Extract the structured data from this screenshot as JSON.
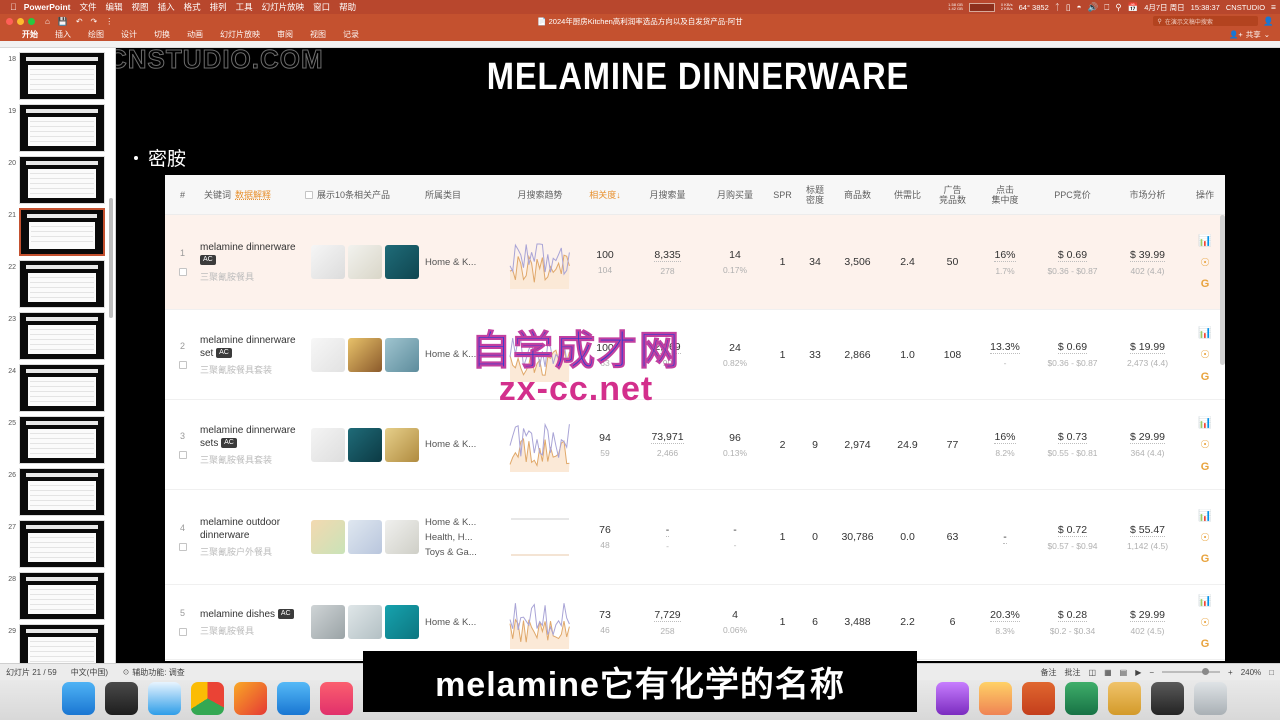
{
  "menubar": {
    "apple": "apple-logo",
    "items": [
      "PowerPoint",
      "文件",
      "编辑",
      "视图",
      "插入",
      "格式",
      "排列",
      "工具",
      "幻灯片放映",
      "窗口",
      "帮助"
    ],
    "net_up": "1.58 GB",
    "net_down": "1.42 GB",
    "cpu_up": "0 KB/s",
    "cpu_down": "2 KB/s",
    "temp": "64° 3852",
    "battery": "18%",
    "date": "4月7日 周日",
    "time": "15:38:37",
    "user": "CNSTUDIO"
  },
  "titlebar": {
    "document": "2024年厨房Kitchen高利润率选品方向以及自发货产品-阿甘",
    "quick_access": [
      "home-icon",
      "save-icon",
      "undo-icon",
      "redo-icon",
      "add-icon"
    ],
    "search_placeholder": "在演示文稿中搜索",
    "share_label": "共享"
  },
  "ribbon": {
    "tabs": [
      "开始",
      "插入",
      "绘图",
      "设计",
      "切换",
      "动画",
      "幻灯片放映",
      "审阅",
      "视图",
      "记录"
    ],
    "active_tab": "开始"
  },
  "slide_panel": {
    "slides": [
      {
        "number": "18"
      },
      {
        "number": "19"
      },
      {
        "number": "20"
      },
      {
        "number": "21",
        "selected": true
      },
      {
        "number": "22"
      },
      {
        "number": "23"
      },
      {
        "number": "24"
      },
      {
        "number": "25"
      },
      {
        "number": "26"
      },
      {
        "number": "27"
      },
      {
        "number": "28"
      },
      {
        "number": "29"
      }
    ]
  },
  "slide": {
    "title": "MELAMINE DINNERWARE",
    "bullet": "密胺",
    "watermark_corner": "CNSTUDIO.COM",
    "watermark_line1": "自学成才网",
    "watermark_line2": "zx-cc.net"
  },
  "table": {
    "headers": {
      "index": "#",
      "keyword": "关键词",
      "data_explain": "数据解释",
      "show_related": "展示10条相关产品",
      "category": "所属类目",
      "trend": "月搜索趋势",
      "relevance": "相关度",
      "sort_arrow": "↓",
      "search_volume": "月搜索量",
      "purchase_volume": "月购买量",
      "spr": "SPR",
      "title_density_1": "标题",
      "title_density_2": "密度",
      "product_count": "商品数",
      "supply_demand": "供需比",
      "ad_comp_1": "广告",
      "ad_comp_2": "竞品数",
      "click_conc_1": "点击",
      "click_conc_2": "集中度",
      "ppc": "PPC竞价",
      "market": "市场分析",
      "actions": "操作"
    },
    "rows": [
      {
        "index": "1",
        "keyword": "melamine dinnerware",
        "badge": "AC",
        "keyword_cn": "三聚氰胺餐具",
        "categories": [
          "Home & K..."
        ],
        "relevance": "100",
        "relevance_sub": "104",
        "search_volume": "8,335",
        "search_volume_sub": "278",
        "purchase_volume": "14",
        "purchase_volume_sub": "0.17%",
        "spr": "1",
        "title_density": "34",
        "product_count": "3,506",
        "supply_demand": "2.4",
        "ad_competitors": "50",
        "click_conc": "16%",
        "click_conc_sub": "1.7%",
        "ppc": "$ 0.69",
        "ppc_range": "$0.36 - $0.87",
        "market_price": "$ 39.99",
        "market_sub": "402 (4.4)",
        "highlight": true
      },
      {
        "index": "2",
        "keyword": "melamine dinnerware set",
        "badge": "AC",
        "keyword_cn": "三聚氰胺餐具套装",
        "categories": [
          "Home & K..."
        ],
        "relevance": "100",
        "relevance_sub": "63",
        "search_volume": "2,969",
        "search_volume_sub": "99",
        "purchase_volume": "24",
        "purchase_volume_sub": "0.82%",
        "spr": "1",
        "title_density": "33",
        "product_count": "2,866",
        "supply_demand": "1.0",
        "ad_competitors": "108",
        "click_conc": "13.3%",
        "click_conc_sub": "-",
        "ppc": "$ 0.69",
        "ppc_range": "$0.36 - $0.87",
        "market_price": "$ 19.99",
        "market_sub": "2,473 (4.4)",
        "highlight": false
      },
      {
        "index": "3",
        "keyword": "melamine dinnerware sets",
        "badge": "AC",
        "keyword_cn": "三聚氰胺餐具套装",
        "categories": [
          "Home & K..."
        ],
        "relevance": "94",
        "relevance_sub": "59",
        "search_volume": "73,971",
        "search_volume_sub": "2,466",
        "purchase_volume": "96",
        "purchase_volume_sub": "0.13%",
        "spr": "2",
        "title_density": "9",
        "product_count": "2,974",
        "supply_demand": "24.9",
        "ad_competitors": "77",
        "click_conc": "16%",
        "click_conc_sub": "8.2%",
        "ppc": "$ 0.73",
        "ppc_range": "$0.55 - $0.81",
        "market_price": "$ 29.99",
        "market_sub": "364 (4.4)",
        "highlight": false
      },
      {
        "index": "4",
        "keyword": "melamine outdoor dinnerware",
        "badge": "",
        "keyword_cn": "三聚氰胺户外餐具",
        "categories": [
          "Home & K...",
          "Health, H...",
          "Toys & Ga..."
        ],
        "relevance": "76",
        "relevance_sub": "48",
        "search_volume": "-",
        "search_volume_sub": "-",
        "purchase_volume": "-",
        "purchase_volume_sub": "-",
        "spr": "1",
        "title_density": "0",
        "product_count": "30,786",
        "supply_demand": "0.0",
        "ad_competitors": "63",
        "click_conc": "-",
        "click_conc_sub": "",
        "ppc": "$ 0.72",
        "ppc_range": "$0.57 - $0.94",
        "market_price": "$ 55.47",
        "market_sub": "1,142 (4.5)",
        "highlight": false
      },
      {
        "index": "5",
        "keyword": "melamine dishes",
        "badge": "AC",
        "keyword_cn": "三聚氰胺餐具",
        "categories": [
          "Home & K..."
        ],
        "relevance": "73",
        "relevance_sub": "46",
        "search_volume": "7,729",
        "search_volume_sub": "258",
        "purchase_volume": "4",
        "purchase_volume_sub": "0.06%",
        "spr": "1",
        "title_density": "6",
        "product_count": "3,488",
        "supply_demand": "2.2",
        "ad_competitors": "6",
        "click_conc": "20.3%",
        "click_conc_sub": "8.3%",
        "ppc": "$ 0.28",
        "ppc_range": "$0.2 - $0.34",
        "market_price": "$ 29.99",
        "market_sub": "402 (4.5)",
        "highlight": false
      }
    ],
    "action_icons": [
      "bar-chart-icon",
      "more-circle-icon",
      "google-icon"
    ]
  },
  "subtitle": {
    "text": "melamine它有化学的名称"
  },
  "statusbar": {
    "slide_count": "幻灯片 21 / 59",
    "language": "中文(中国)",
    "accessibility": "辅助功能: 调查",
    "notes": "备注",
    "comments": "批注",
    "zoom": "240%"
  },
  "dock": {
    "left_icons": [
      "finder-icon",
      "launchpad-icon",
      "safari-icon",
      "chrome-icon",
      "design-app-icon",
      "mail-icon",
      "music-icon"
    ],
    "right_icons": [
      "podcast-icon",
      "keynote-icon",
      "powerpoint-icon",
      "excel-icon",
      "folder-icon",
      "terminal-icon",
      "trash-icon"
    ]
  },
  "colors": {
    "brand": "#c4512f",
    "accent": "#e8912f",
    "row_highlight": "#fdf2ec"
  }
}
